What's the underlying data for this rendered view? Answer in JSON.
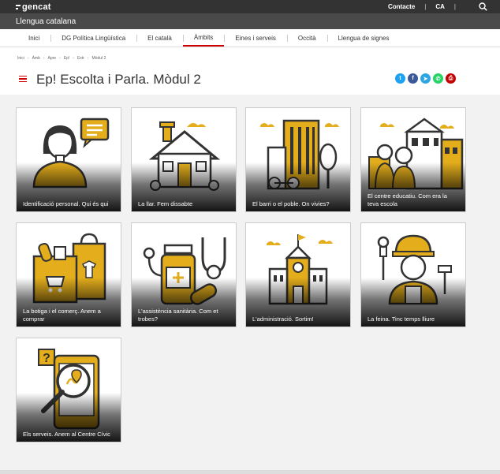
{
  "brand": {
    "logo_text": "gencat"
  },
  "top_links": {
    "contact": "Contacte",
    "lang": "CA"
  },
  "site_name": "Llengua catalana",
  "nav": [
    {
      "label": "Inici",
      "active": false
    },
    {
      "label": "DG Política Lingüística",
      "active": false
    },
    {
      "label": "El català",
      "active": false
    },
    {
      "label": "Àmbits",
      "active": true
    },
    {
      "label": "Eines i serveis",
      "active": false
    },
    {
      "label": "Occità",
      "active": false
    },
    {
      "label": "Llengua de signes",
      "active": false
    }
  ],
  "breadcrumb": [
    "Inici",
    "Àmb",
    "Apre",
    "Ep!",
    "Extr",
    "Mòdul 2"
  ],
  "page_title": "Ep! Escolta i Parla. Mòdul 2",
  "share": [
    {
      "icon": "twitter-icon",
      "color": "#1da1f2"
    },
    {
      "icon": "facebook-icon",
      "color": "#3b5998"
    },
    {
      "icon": "telegram-icon",
      "color": "#2ca5e0"
    },
    {
      "icon": "whatsapp-icon",
      "color": "#25d366"
    },
    {
      "icon": "print-icon",
      "color": "#c00000"
    }
  ],
  "cards": [
    {
      "label": "Identificació personal. Qui és qui",
      "icon": "person-speech-icon"
    },
    {
      "label": "La llar. Fem dissabte",
      "icon": "house-icon"
    },
    {
      "label": "El barri o el poble. On vivies?",
      "icon": "neighbourhood-icon"
    },
    {
      "label": "El centre educatiu. Com era la teva escola",
      "icon": "school-icon"
    },
    {
      "label": "La botiga i el comerç. Anem a comprar",
      "icon": "shopping-icon"
    },
    {
      "label": "L'assistència sanitària. Com et trobes?",
      "icon": "medical-icon"
    },
    {
      "label": "L'administració. Sortim!",
      "icon": "town-hall-icon"
    },
    {
      "label": "La feina. Tinc temps lliure",
      "icon": "worker-icon"
    },
    {
      "label": "Els serveis. Anem al Centre Cívic",
      "icon": "phone-map-icon"
    }
  ],
  "colors": {
    "accent": "#c00000",
    "icon_yellow": "#e3ad1c",
    "dark": "#333333"
  }
}
